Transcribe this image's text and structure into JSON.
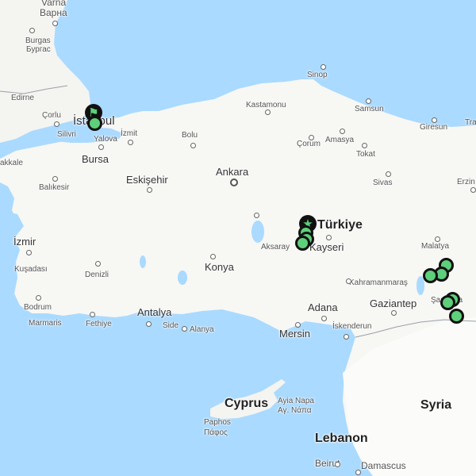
{
  "map": {
    "countries": {
      "turkey": "Türkiye",
      "syria": "Syria",
      "lebanon": "Lebanon",
      "cyprus": "Cyprus"
    },
    "cities": {
      "varna_latin": "Varna",
      "varna_cyr": "Варна",
      "burgas_latin": "Burgas",
      "burgas_cyr": "Бургас",
      "edirne": "Edirne",
      "corlu": "Çorlu",
      "silivri": "Silivri",
      "istanbul": "İstanbul",
      "izmit": "İzmit",
      "yalova": "Yalova",
      "bursa": "Bursa",
      "balikesir": "Balıkesir",
      "akkale": "akkale",
      "izmir": "İzmir",
      "kusadasi": "Kuşadası",
      "denizli": "Denizli",
      "bodrum": "Bodrum",
      "marmaris": "Marmaris",
      "fethiye": "Fethiye",
      "antalya": "Antalya",
      "side": "Side",
      "alanya": "Alanya",
      "eskisehir": "Eskişehir",
      "bolu": "Bolu",
      "kastamonu": "Kastamonu",
      "sinop": "Sinop",
      "samsun": "Samsun",
      "ankara": "Ankara",
      "corum": "Çorum",
      "amasya": "Amasya",
      "tokat": "Tokat",
      "sivas": "Sivas",
      "giresun": "Giresun",
      "tra": "Tra",
      "erzin": "Erzin",
      "kayseri": "Kayseri",
      "aksaray": "Aksaray",
      "konya": "Konya",
      "malatya": "Malatya",
      "kahramanmaras": "Kahramanmaraş",
      "gaziantep": "Gaziantep",
      "sanliurfa": "Şanlıurfa",
      "adana": "Adana",
      "mersin": "Mersin",
      "iskenderun": "İskenderun",
      "ayia_napa_latin": "Ayia Napa",
      "ayia_napa_gr": "Αγ. Νάπα",
      "paphos_latin": "Paphos",
      "paphos_gr": "Πάφος",
      "beirut": "Beirut",
      "damascus": "Damascus"
    },
    "colors": {
      "water": "#aadaff",
      "land": "#f4f4f1",
      "land_alt": "#ffffff",
      "marker_fill": "#5ecf7a",
      "marker_border": "#111111"
    },
    "markers": [
      {
        "type": "pin",
        "icon": "flag-icon",
        "location": "İstanbul"
      },
      {
        "type": "circle",
        "location": "İstanbul"
      },
      {
        "type": "pin",
        "icon": "star-icon",
        "location": "Central Türkiye (near Kayseri)"
      },
      {
        "type": "circle",
        "location": "Central Türkiye"
      },
      {
        "type": "circle",
        "location": "Central Türkiye"
      },
      {
        "type": "circle",
        "location": "Central Türkiye"
      },
      {
        "type": "circle",
        "location": "Malatya region"
      },
      {
        "type": "circle",
        "location": "Malatya region"
      },
      {
        "type": "circle",
        "location": "Malatya region"
      },
      {
        "type": "circle",
        "location": "Şanlıurfa region"
      },
      {
        "type": "circle",
        "location": "Şanlıurfa region"
      },
      {
        "type": "circle",
        "location": "Şanlıurfa region"
      }
    ]
  }
}
